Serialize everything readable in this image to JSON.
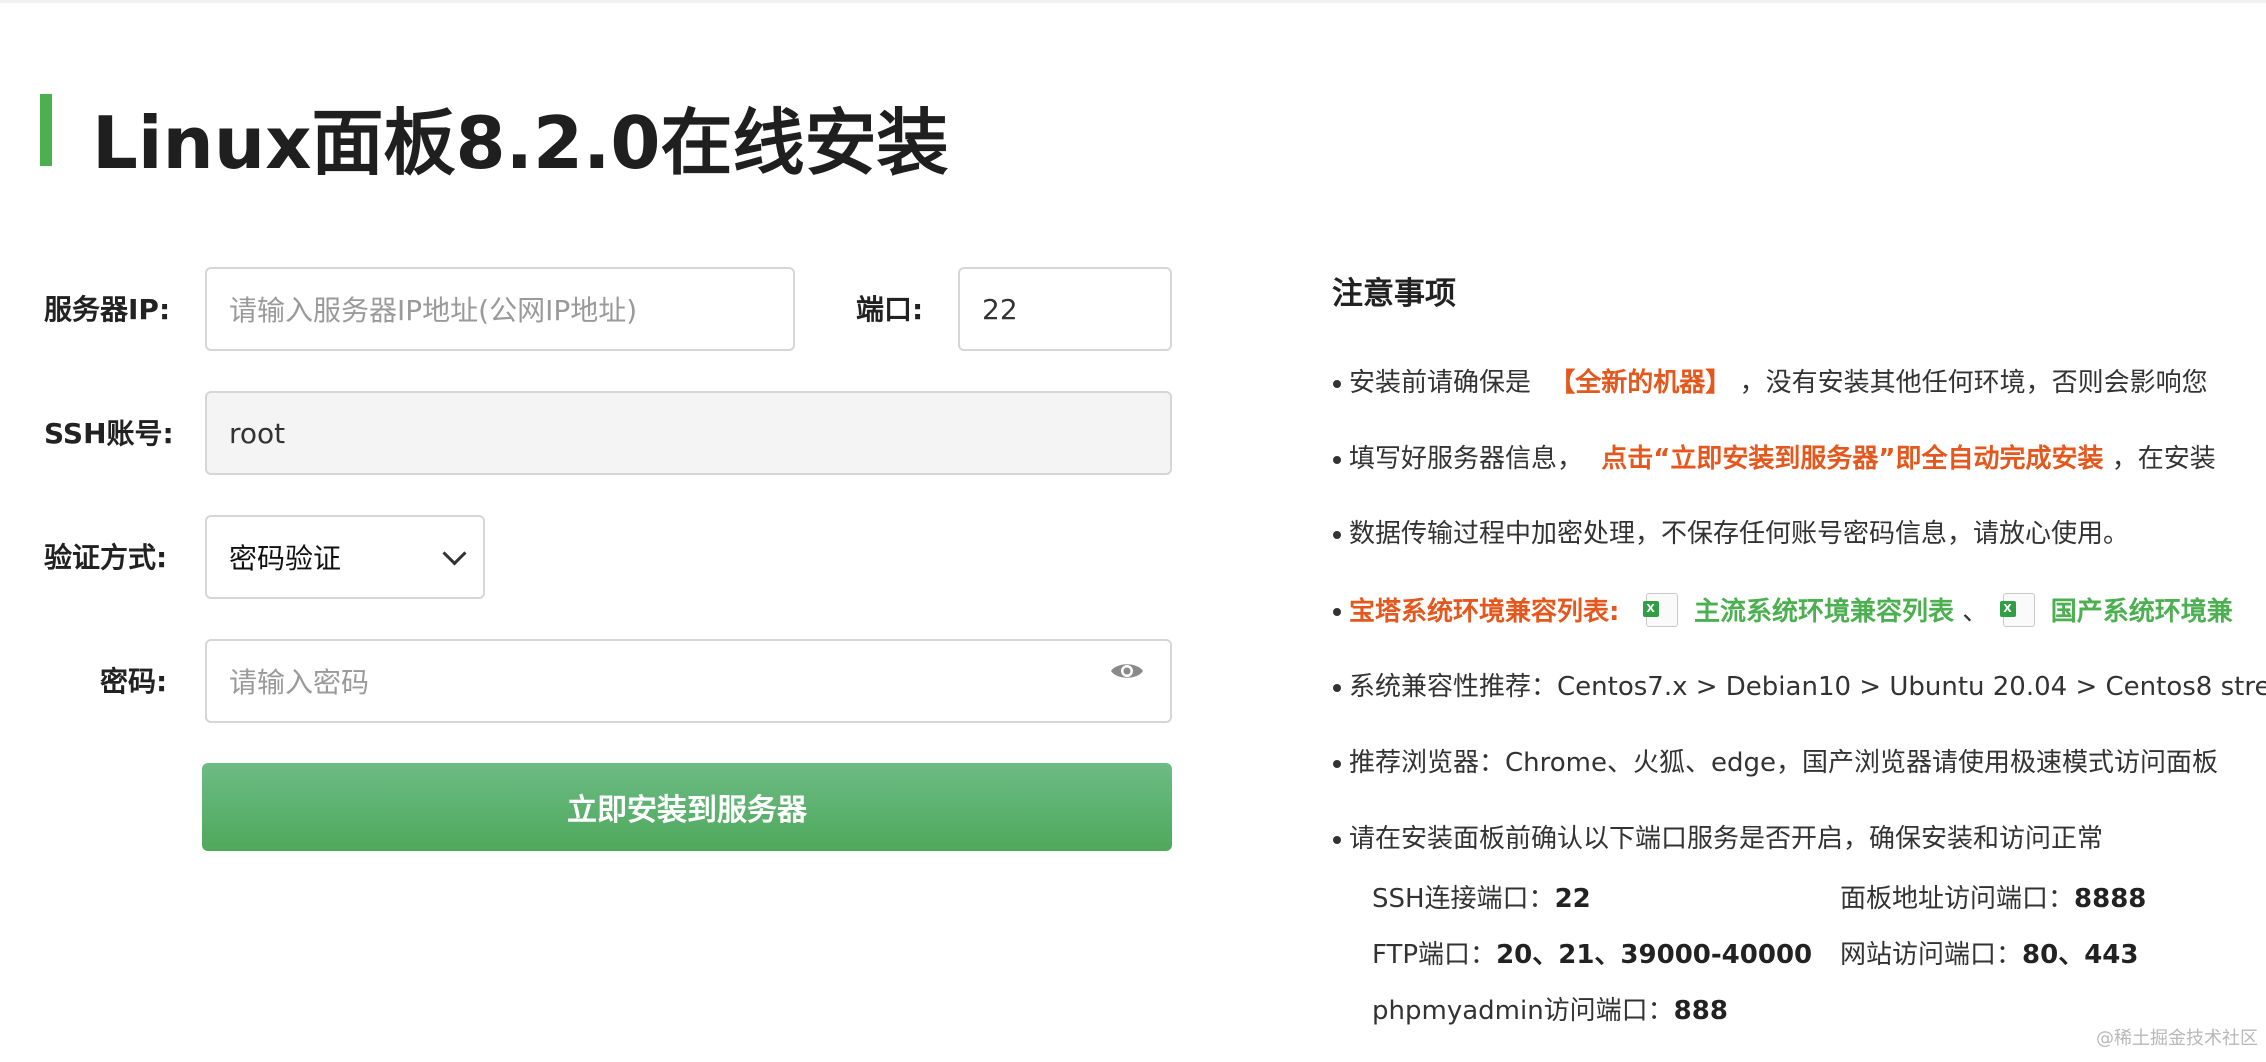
{
  "page_title": "Linux面板8.2.0在线安装",
  "form": {
    "server_ip_label": "服务器IP:",
    "server_ip_placeholder": "请输入服务器IP地址(公网IP地址)",
    "port_label": "端口:",
    "port_value": "22",
    "ssh_account_label": "SSH账号:",
    "ssh_account_value": "root",
    "auth_label": "验证方式:",
    "auth_selected": "密码验证",
    "password_label": "密码:",
    "password_placeholder": "请输入密码",
    "install_button": "立即安装到服务器"
  },
  "notes": {
    "title": "注意事项",
    "n1_pre": "安装前请确保是",
    "n1_highlight": "【全新的机器】",
    "n1_post": "，没有安装其他任何环境，否则会影响您",
    "n2_pre": "填写好服务器信息，",
    "n2_highlight": "点击“立即安装到服务器”即全自动完成安装",
    "n2_post": "，在安装",
    "n3": "数据传输过程中加密处理，不保存任何账号密码信息，请放心使用。",
    "n4_label": "宝塔系统环境兼容列表:",
    "n4_link1": "主流系统环境兼容列表",
    "n4_sep": "、",
    "n4_link2": "国产系统环境兼",
    "n5": "系统兼容性推荐：Centos7.x > Debian10 > Ubuntu 20.04 > Centos8 strea",
    "n6": "推荐浏览器：Chrome、火狐、edge，国产浏览器请使用极速模式访问面板",
    "n7": "请在安装面板前确认以下端口服务是否开启，确保安装和访问正常",
    "ports": {
      "ssh_label": "SSH连接端口：",
      "ssh_value": "22",
      "panel_label": "面板地址访问端口：",
      "panel_value": "8888",
      "ftp_label": "FTP端口：",
      "ftp_value": "20、21、39000-40000",
      "web_label": "网站访问端口：",
      "web_value": "80、443",
      "pma_label": "phpmyadmin访问端口：",
      "pma_value": "888"
    }
  },
  "icons": {
    "password_toggle": "eye-icon",
    "excel": "excel-file-icon",
    "select_arrow": "chevron-down-icon"
  },
  "colors": {
    "accent_green": "#4caf50",
    "highlight_orange": "#e5581d"
  },
  "watermark": "@稀土掘金技术社区"
}
